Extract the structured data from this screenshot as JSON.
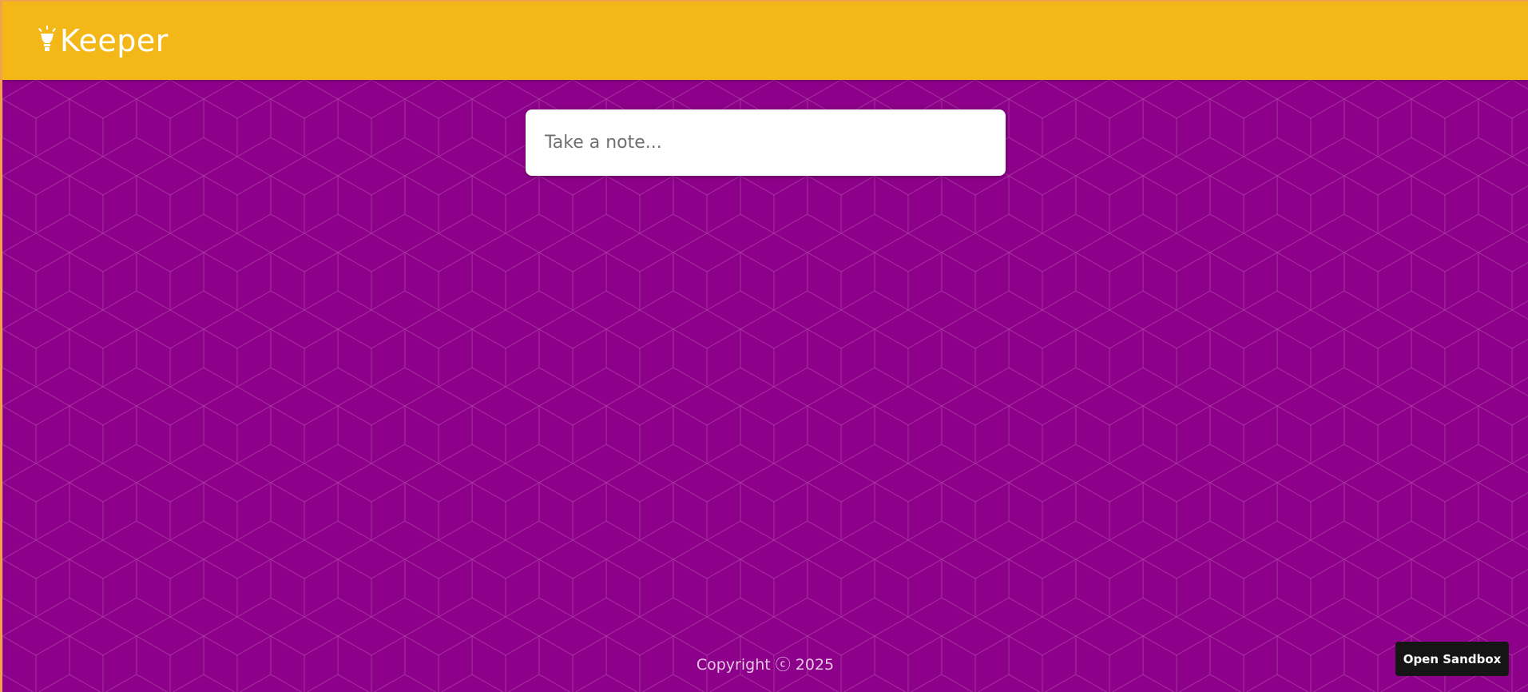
{
  "header": {
    "app_name": "Keeper",
    "background_color": "#f3b817"
  },
  "note_input": {
    "placeholder": "Take a note..."
  },
  "footer": {
    "copyright_text": "Copyright ⓒ 2025"
  },
  "sandbox_button": {
    "label": "Open Sandbox"
  },
  "colors": {
    "page_background": "#8d0089",
    "header": "#f3b817",
    "button": "#151515"
  },
  "icons": {
    "logo": "lightbulb-icon"
  }
}
